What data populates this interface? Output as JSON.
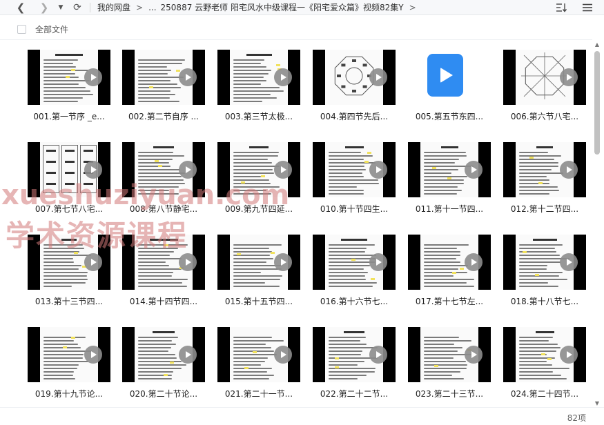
{
  "nav": {
    "back_icon": "chevron-left-icon",
    "forward_icon": "chevron-right-icon",
    "dropdown_icon": "caret-down-icon",
    "refresh_icon": "refresh-icon",
    "back_glyph": "❮",
    "forward_glyph": "❯",
    "dropdown_glyph": "▼",
    "refresh_glyph": "⟳"
  },
  "breadcrumb": {
    "root": "我的网盘",
    "sep": ">",
    "ellipsis": "...",
    "path": "250887 云野老师 阳宅风水中级课程一《阳宅爱众篇》视频82集Y",
    "trailing_sep": ">"
  },
  "toolbar": {
    "sort_icon": "sort-icon",
    "menu_icon": "hamburger-menu-icon"
  },
  "header": {
    "all_files_label": "全部文件"
  },
  "files": [
    {
      "name": "001.第一节序 _e...",
      "kind": "doc"
    },
    {
      "name": "002.第二节自序 ...",
      "kind": "doc"
    },
    {
      "name": "003.第三节太极...",
      "kind": "doc"
    },
    {
      "name": "004.第四节先后...",
      "kind": "bagua"
    },
    {
      "name": "005.第五节东四...",
      "kind": "video-icon"
    },
    {
      "name": "006.第六节八宅...",
      "kind": "bagua2"
    },
    {
      "name": "007.第七节八宅...",
      "kind": "table"
    },
    {
      "name": "008.第八节静宅...",
      "kind": "doc"
    },
    {
      "name": "009.第九节四延...",
      "kind": "doc"
    },
    {
      "name": "010.第十节四生...",
      "kind": "doc"
    },
    {
      "name": "011.第十一节四...",
      "kind": "doc"
    },
    {
      "name": "012.第十二节四...",
      "kind": "doc"
    },
    {
      "name": "013.第十三节四...",
      "kind": "doc"
    },
    {
      "name": "014.第十四节四...",
      "kind": "doc"
    },
    {
      "name": "015.第十五节四...",
      "kind": "doc"
    },
    {
      "name": "016.第十六节七...",
      "kind": "doc"
    },
    {
      "name": "017.第十七节左...",
      "kind": "doc"
    },
    {
      "name": "018.第十八节七...",
      "kind": "doc"
    },
    {
      "name": "019.第十九节论...",
      "kind": "doc"
    },
    {
      "name": "020.第二十节论...",
      "kind": "doc"
    },
    {
      "name": "021.第二十一节...",
      "kind": "doc"
    },
    {
      "name": "022.第二十二节...",
      "kind": "doc"
    },
    {
      "name": "023.第二十三节...",
      "kind": "doc"
    },
    {
      "name": "024.第二十四节...",
      "kind": "doc"
    }
  ],
  "footer": {
    "count": "82项"
  },
  "watermark": {
    "line1": "xueshuziyuan.com",
    "line2": "学术资源课程"
  },
  "colors": {
    "accent": "#2f8cf2",
    "watermark": "#d27878"
  }
}
